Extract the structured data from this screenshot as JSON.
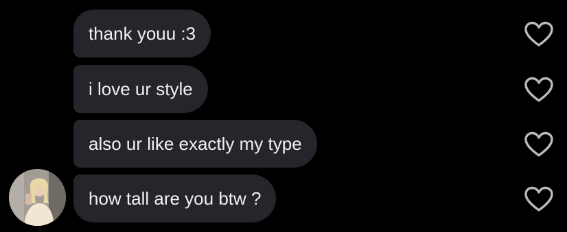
{
  "conversation": {
    "messages": [
      {
        "text": "thank youu :3",
        "liked": false
      },
      {
        "text": "i love ur style",
        "liked": false
      },
      {
        "text": "also ur like exactly my type",
        "liked": false
      },
      {
        "text": "how tall are you btw ?",
        "liked": false
      }
    ]
  },
  "icons": {
    "like": "heart-outline-icon",
    "avatar": "sender-avatar"
  },
  "colors": {
    "background": "#000000",
    "bubble": "#25262b",
    "bubble_text": "#f1f1f1",
    "heart_outline": "#b9b9b9"
  }
}
